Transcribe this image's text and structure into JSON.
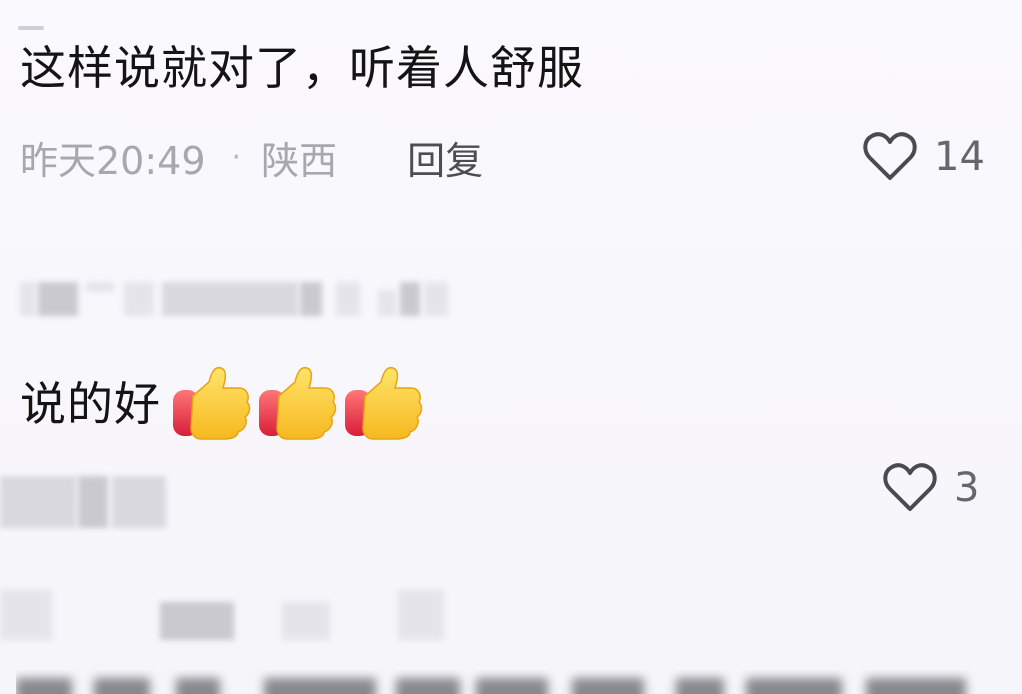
{
  "comments": [
    {
      "text": "这样说就对了，听着人舒服",
      "time": "昨天20:49",
      "separator": "·",
      "location": "陕西",
      "reply_label": "回复",
      "likes": "14"
    },
    {
      "text": "说的好",
      "emoji_icons": [
        "thumbs-up-icon",
        "thumbs-up-icon",
        "thumbs-up-icon"
      ],
      "likes": "3"
    }
  ],
  "icons": {
    "like": "heart-outline-icon",
    "emoji": "thumbs-up-icon"
  },
  "colors": {
    "background": "#f7f6fa",
    "text": "#141414",
    "meta": "#a7a7ad",
    "reply": "#4d4d52"
  }
}
